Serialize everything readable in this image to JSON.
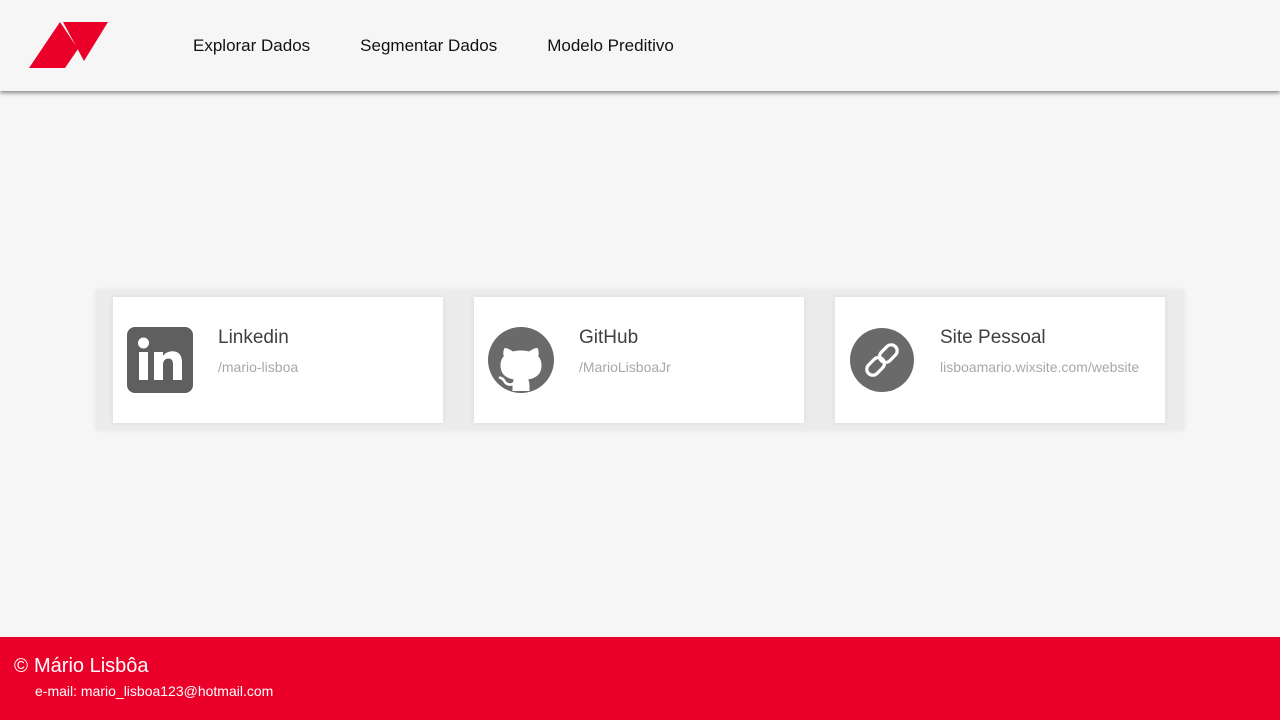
{
  "brand": {
    "logo_icon": "red-geometric-triangle-logo-icon",
    "color_primary": "#eb0029",
    "color_background": "#f6f6f6"
  },
  "nav": {
    "items": [
      {
        "label": "Explorar Dados"
      },
      {
        "label": "Segmentar Dados"
      },
      {
        "label": "Modelo Preditivo"
      }
    ]
  },
  "cards": [
    {
      "title": "Linkedin",
      "handle": "/mario-lisboa",
      "icon": "linkedin-icon"
    },
    {
      "title": "GitHub",
      "handle": "/MarioLisboaJr",
      "icon": "github-icon"
    },
    {
      "title": "Site Pessoal",
      "handle": "lisboamario.wixsite.com/website",
      "icon": "link-icon"
    }
  ],
  "footer": {
    "copyright_symbol": "©",
    "name": "Mário Lisbôa",
    "email": "e-mail: mario_lisboa123@hotmail.com"
  }
}
